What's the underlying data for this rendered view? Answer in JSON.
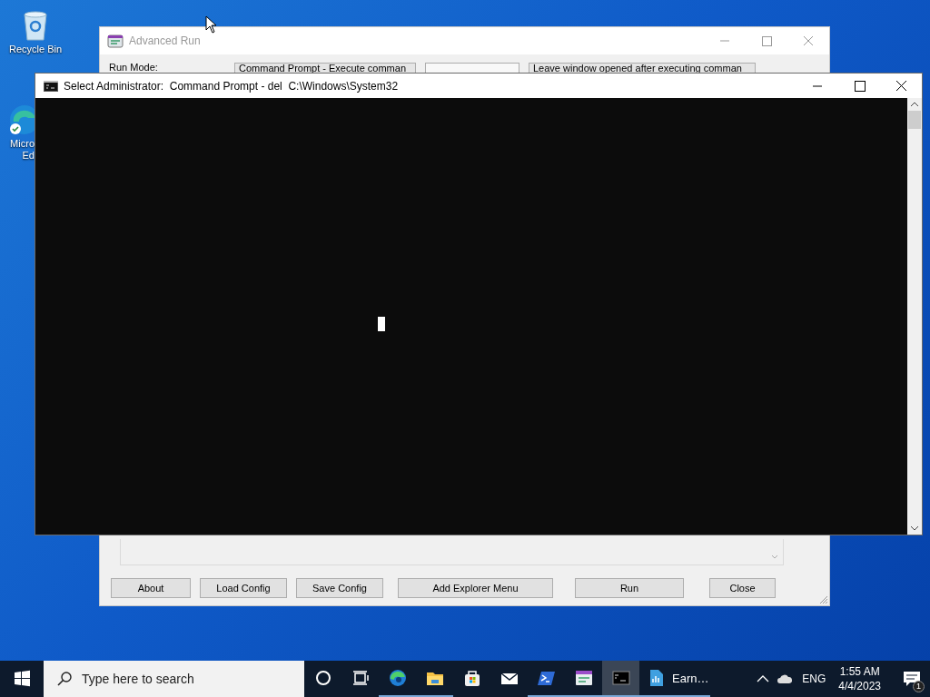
{
  "desktop": {
    "icons": [
      {
        "kind": "recycle-bin",
        "lines": [
          "Recycle Bin"
        ]
      },
      {
        "kind": "browser",
        "lines": [
          "Micro",
          "Ed"
        ]
      }
    ]
  },
  "advanced_run": {
    "title": "Advanced Run",
    "run_mode_label": "Run Mode:",
    "run_mode_value": "Command Prompt - Execute comman",
    "window_option": "Leave window opened after executing comman",
    "buttons": [
      "About",
      "Load Config",
      "Save Config",
      "Add Explorer Menu",
      "Run",
      "Close"
    ]
  },
  "command_prompt": {
    "title": "Select Administrator:  Command Prompt - del  C:\\Windows\\System32"
  },
  "taskbar": {
    "search_placeholder": "Type here to search",
    "apps": [
      {
        "kind": "cortana",
        "running": false,
        "selected": false
      },
      {
        "kind": "taskview",
        "running": false,
        "selected": false
      },
      {
        "kind": "edge",
        "running": true,
        "selected": false
      },
      {
        "kind": "explorer",
        "running": true,
        "selected": false
      },
      {
        "kind": "store",
        "running": false,
        "selected": false
      },
      {
        "kind": "mail",
        "running": false,
        "selected": false
      },
      {
        "kind": "powershell",
        "running": true,
        "selected": false
      },
      {
        "kind": "advancedrun",
        "running": true,
        "selected": false
      },
      {
        "kind": "cmd",
        "running": true,
        "selected": true
      },
      {
        "kind": "document",
        "running": true,
        "selected": false,
        "label": "Earn…"
      }
    ],
    "language": "ENG",
    "time": "1:55 AM",
    "date": "4/4/2023",
    "notification_count": "1"
  }
}
